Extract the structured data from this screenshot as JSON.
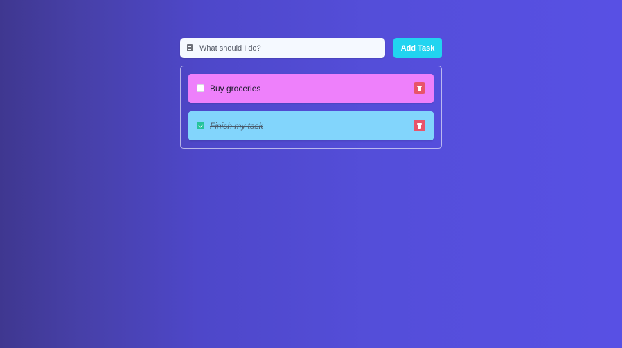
{
  "form": {
    "input_placeholder": "What should I do?",
    "input_value": "",
    "input_icon": "clipboard-icon",
    "add_button_label": "Add Task"
  },
  "tasks": [
    {
      "label": "Buy groceries",
      "completed": false,
      "color": "#ee80fb",
      "delete_icon": "trash-icon"
    },
    {
      "label": "Finish my task",
      "completed": true,
      "color": "#82d5fc",
      "delete_icon": "trash-icon"
    }
  ],
  "colors": {
    "accent": "#21d4f0",
    "delete": "#e8546a",
    "check": "#27c39a"
  }
}
